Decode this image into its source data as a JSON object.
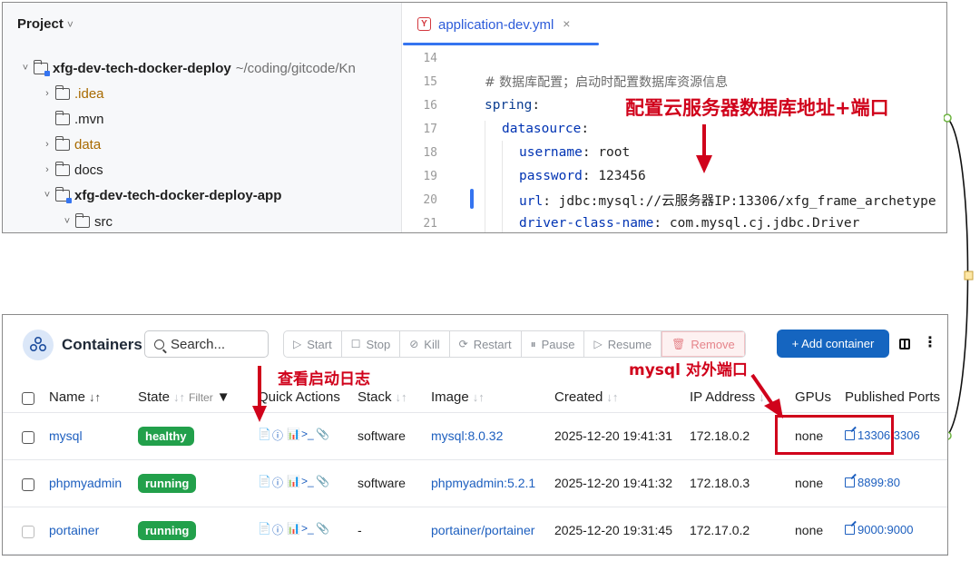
{
  "ide": {
    "project_label": "Project",
    "tree": [
      {
        "name": "xfg-dev-tech-docker-deploy",
        "path": "~/coding/gitcode/Kn",
        "arrow": "˅",
        "module": true,
        "bold": true
      },
      {
        "name": ".idea",
        "arrow": "›",
        "orange": true
      },
      {
        "name": ".mvn",
        "arrow": ""
      },
      {
        "name": "data",
        "arrow": "›",
        "orange": true
      },
      {
        "name": "docs",
        "arrow": "›"
      },
      {
        "name": "xfg-dev-tech-docker-deploy-app",
        "arrow": "˅",
        "module": true,
        "bold": true
      },
      {
        "name": "src",
        "arrow": "˅"
      }
    ],
    "tab": {
      "icon_text": "Y",
      "label": "application-dev.yml",
      "close": "×"
    },
    "lines": [
      {
        "n": "14",
        "text": ""
      },
      {
        "n": "15",
        "comment": "# 数据库配置；启动时配置数据库资源信息"
      },
      {
        "n": "16",
        "key": "spring",
        "sep": ":",
        "indent": 0
      },
      {
        "n": "17",
        "key": "datasource",
        "sep": ":",
        "indent": 1
      },
      {
        "n": "18",
        "key": "username",
        "sep": ": ",
        "value": "root",
        "indent": 2
      },
      {
        "n": "19",
        "key": "password",
        "sep": ": ",
        "value": "123456",
        "indent": 2
      },
      {
        "n": "20",
        "key": "url",
        "sep": ": ",
        "value": "jdbc:mysql://云服务器IP:13306/xfg_frame_archetype",
        "indent": 2
      },
      {
        "n": "21",
        "key": "driver-class-name",
        "sep": ": ",
        "value": "com.mysql.cj.jdbc.Driver",
        "indent": 2
      }
    ],
    "annotation": "配置云服务器数据库地址+端口"
  },
  "docker": {
    "title": "Containers",
    "search_placeholder": "Search...",
    "buttons": [
      {
        "icon": "▷",
        "label": "Start"
      },
      {
        "icon": "☐",
        "label": "Stop"
      },
      {
        "icon": "⊘",
        "label": "Kill"
      },
      {
        "icon": "⟳",
        "label": "Restart"
      },
      {
        "icon": "⏸",
        "label": "Pause"
      },
      {
        "icon": "▷",
        "label": "Resume"
      },
      {
        "icon": "🗑",
        "label": "Remove"
      }
    ],
    "add_label": "+ Add container",
    "headers": {
      "name": "Name",
      "name_sort": "↓↑",
      "state": "State",
      "state_sort": "↓↑",
      "filter": "Filter",
      "quick_actions": "Quick Actions",
      "stack": "Stack",
      "stack_sort": "↓↑",
      "image": "Image",
      "image_sort": "↓↑",
      "created": "Created",
      "created_sort": "↓↑",
      "ip": "IP Address",
      "ip_sort": "↓↑",
      "gpus": "GPUs",
      "ports": "Published Ports"
    },
    "rows": [
      {
        "name": "mysql",
        "state": "healthy",
        "stack": "software",
        "image": "mysql:8.0.32",
        "created": "2025-12-20 19:41:31",
        "ip": "172.18.0.2",
        "gpus": "none",
        "ports": "13306:3306"
      },
      {
        "name": "phpmyadmin",
        "state": "running",
        "stack": "software",
        "image": "phpmyadmin:5.2.1",
        "created": "2025-12-20 19:41:32",
        "ip": "172.18.0.3",
        "gpus": "none",
        "ports": "8899:80"
      },
      {
        "name": "portainer",
        "state": "running",
        "stack": "-",
        "image": "portainer/portainer",
        "created": "2025-12-20 19:31:45",
        "ip": "172.17.0.2",
        "gpus": "none",
        "ports": "9000:9000"
      }
    ],
    "quick_action_icons": [
      "📄",
      "ⓘ",
      "📊",
      ">_",
      "📎"
    ],
    "annotation_logs": "查看启动日志",
    "annotation_port": "mysql 对外端口"
  },
  "colors": {
    "accent": "#3574f0",
    "annotation": "#d0021b",
    "badge": "#22a04b",
    "primary_button": "#1565c0"
  }
}
